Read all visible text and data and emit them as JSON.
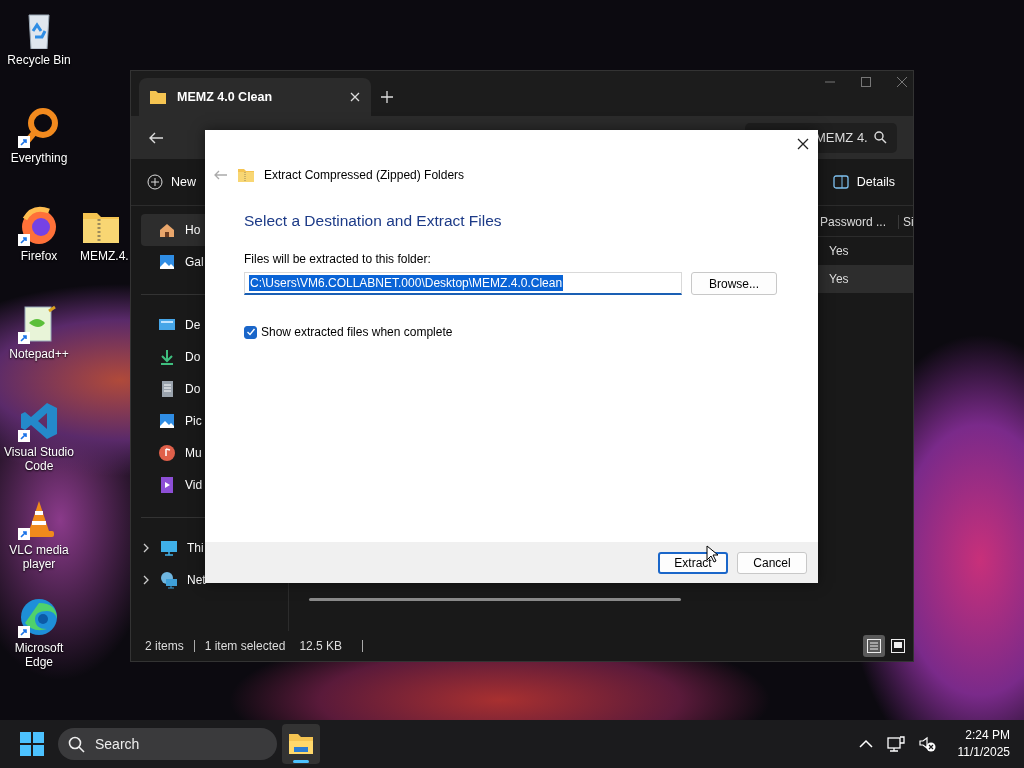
{
  "desktop": {
    "icons": [
      {
        "label": "Recycle Bin",
        "kind": "recycle-bin",
        "shortcut": false
      },
      {
        "label": "Everything",
        "kind": "everything",
        "shortcut": true
      },
      {
        "label": "Firefox",
        "kind": "firefox",
        "shortcut": true
      },
      {
        "label": "MEMZ.4.",
        "kind": "zip-folder",
        "shortcut": false
      },
      {
        "label": "Notepad++",
        "kind": "notepad",
        "shortcut": true
      },
      {
        "label": "Visual Studio Code",
        "kind": "vscode",
        "shortcut": true
      },
      {
        "label": "VLC media player",
        "kind": "vlc",
        "shortcut": true
      },
      {
        "label": "Microsoft Edge",
        "kind": "edge",
        "shortcut": true
      }
    ]
  },
  "explorer": {
    "tab": {
      "title": "MEMZ 4.0 Clean"
    },
    "search": {
      "placeholder": "MEMZ 4."
    },
    "toolbar": {
      "new": "New",
      "details": "Details"
    },
    "sidebar": {
      "groups": [
        [
          {
            "label": "Ho",
            "kind": "home",
            "selected": true
          },
          {
            "label": "Gal",
            "kind": "gallery",
            "selected": false
          }
        ],
        [
          {
            "label": "De",
            "kind": "desktop",
            "selected": false
          },
          {
            "label": "Do",
            "kind": "downloads",
            "selected": false
          },
          {
            "label": "Do",
            "kind": "documents",
            "selected": false
          },
          {
            "label": "Pic",
            "kind": "pictures",
            "selected": false
          },
          {
            "label": "Mu",
            "kind": "music",
            "selected": false
          },
          {
            "label": "Vid",
            "kind": "videos",
            "selected": false
          }
        ],
        [
          {
            "label": "Thi",
            "kind": "pc",
            "selected": false,
            "expanded": false
          },
          {
            "label": "Net",
            "kind": "network",
            "selected": false,
            "expanded": false
          }
        ]
      ]
    },
    "columns": [
      "Password ...",
      "Si"
    ],
    "rows": [
      {
        "password": "Yes",
        "selected": false
      },
      {
        "password": "Yes",
        "selected": true
      }
    ],
    "status_bar": {
      "item_count": "2 items",
      "selection": "1 item selected",
      "size": "12.5 KB"
    },
    "views": [
      {
        "kind": "details",
        "selected": true
      },
      {
        "kind": "tiles",
        "selected": false
      }
    ]
  },
  "dialog": {
    "title": "Extract Compressed (Zipped) Folders",
    "heading": "Select a Destination and Extract Files",
    "destination_label": "Files will be extracted to this folder:",
    "destination": {
      "value": "C:\\Users\\VM6.COLLABNET.000\\Desktop\\MEMZ.4.0.Clean",
      "selected": true
    },
    "browse": "Browse...",
    "show_files": {
      "label": "Show extracted files when complete",
      "checked": true
    },
    "buttons": [
      {
        "label": "Extract",
        "default": true
      },
      {
        "label": "Cancel",
        "default": false
      }
    ]
  },
  "taskbar": {
    "search": {
      "placeholder": "Search"
    },
    "apps": [
      {
        "kind": "file-explorer",
        "selected": true
      }
    ],
    "clock": {
      "time": "2:24 PM",
      "date": "11/1/2025"
    }
  }
}
